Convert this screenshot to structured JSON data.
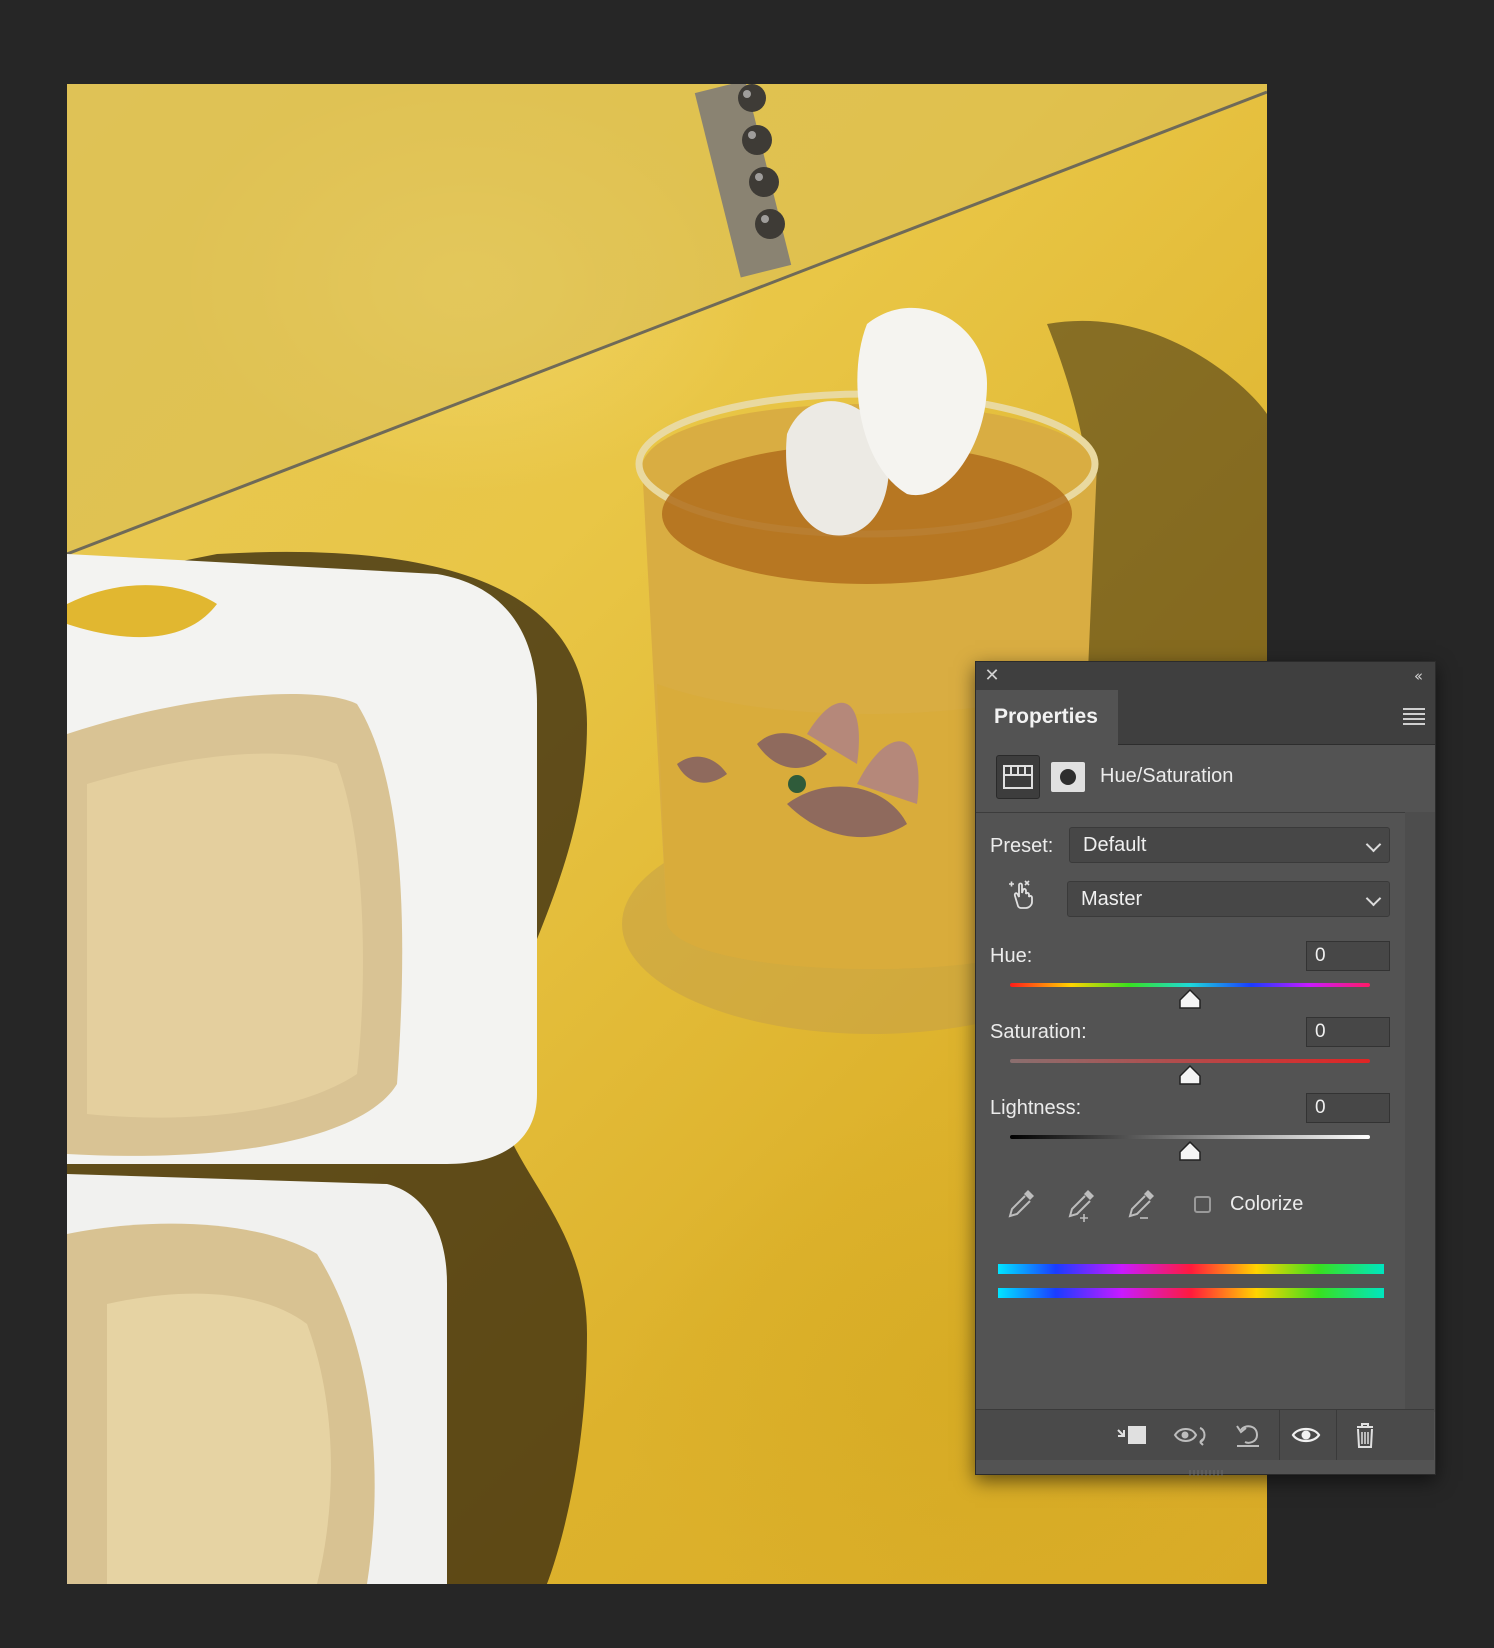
{
  "panel": {
    "close_glyph": "✕",
    "collapse_glyph": "‹‹",
    "tab_label": "Properties",
    "adjustment_name": "Hue/Saturation",
    "preset_label": "Preset:",
    "preset_value": "Default",
    "channel_value": "Master",
    "hue": {
      "label": "Hue:",
      "value": "0",
      "level_fraction": 0.5
    },
    "saturation": {
      "label": "Saturation:",
      "value": "0",
      "level_fraction": 0.5
    },
    "lightness": {
      "label": "Lightness:",
      "value": "0",
      "level_fraction": 0.5
    },
    "colorize_label": "Colorize",
    "colorize_checked": false,
    "icons": {
      "adjustment": "hue-saturation-adjustment-icon",
      "mask": "layer-mask-icon",
      "target": "on-image-adjustment-hand-icon",
      "eyedropper": "eyedropper-icon",
      "eyedropper_add": "eyedropper-add-icon",
      "eyedropper_subtract": "eyedropper-subtract-icon",
      "clip": "clip-to-layer-icon",
      "view_previous": "view-previous-state-icon",
      "reset": "reset-icon",
      "visibility": "eye-icon",
      "delete": "trash-icon",
      "menu": "panel-menu-icon"
    }
  },
  "colors": {
    "app_background": "#262626",
    "panel_background": "#535353",
    "panel_header": "#3f3f3f",
    "photo_table": "#e3bd3c"
  }
}
